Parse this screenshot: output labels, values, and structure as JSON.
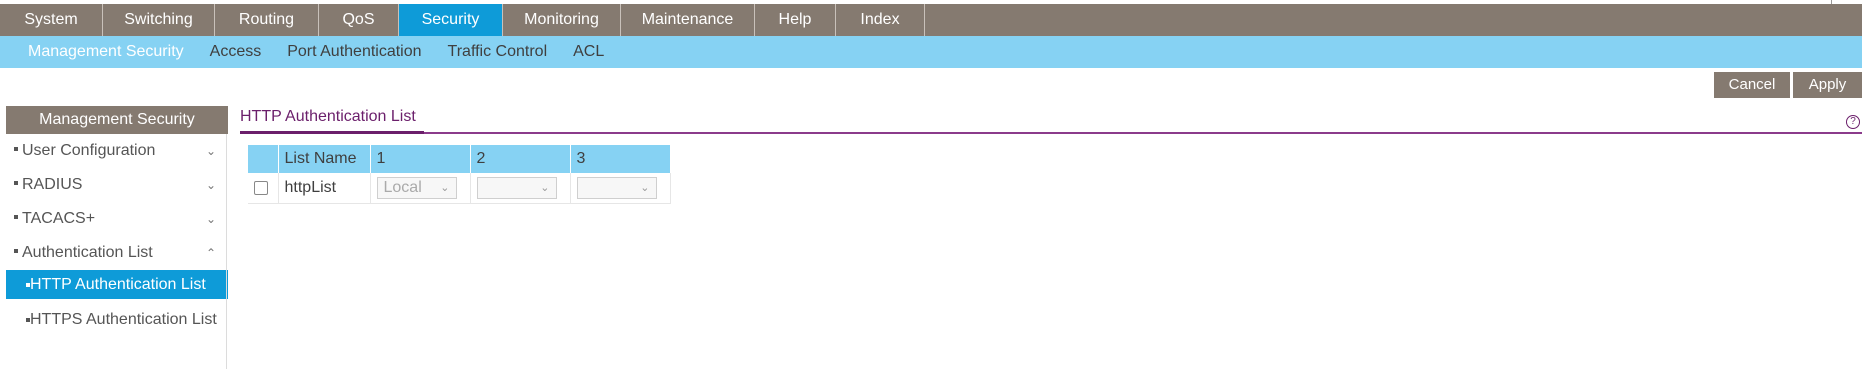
{
  "topnav": [
    {
      "label": "System"
    },
    {
      "label": "Switching"
    },
    {
      "label": "Routing"
    },
    {
      "label": "QoS"
    },
    {
      "label": "Security",
      "active": true
    },
    {
      "label": "Monitoring"
    },
    {
      "label": "Maintenance"
    },
    {
      "label": "Help"
    },
    {
      "label": "Index"
    }
  ],
  "subnav": [
    {
      "label": "Management Security",
      "active": true
    },
    {
      "label": "Access"
    },
    {
      "label": "Port Authentication"
    },
    {
      "label": "Traffic Control"
    },
    {
      "label": "ACL"
    }
  ],
  "actions": {
    "cancel": "Cancel",
    "apply": "Apply"
  },
  "leftmenu": {
    "title": "Management Security",
    "items": [
      {
        "label": "User Configuration",
        "chevron": "chevron-down"
      },
      {
        "label": "RADIUS",
        "chevron": "chevron-down"
      },
      {
        "label": "TACACS+",
        "chevron": "chevron-down"
      },
      {
        "label": "Authentication List",
        "chevron": "chevron-up"
      }
    ],
    "subitems": [
      {
        "label": "HTTP Authentication List",
        "active": true
      },
      {
        "label": "HTTPS Authentication List"
      }
    ]
  },
  "content": {
    "title": "HTTP Authentication List",
    "help_icon": "?",
    "table": {
      "headers": [
        "",
        "List Name",
        "1",
        "2",
        "3"
      ],
      "rows": [
        {
          "checked": false,
          "name": "httpList",
          "m1": "Local",
          "m2": "",
          "m3": ""
        }
      ]
    }
  },
  "colors": {
    "nav": "#857a70",
    "accent": "#0e9bd8",
    "subnav": "#86d2f3",
    "title": "#6b1f6b"
  }
}
